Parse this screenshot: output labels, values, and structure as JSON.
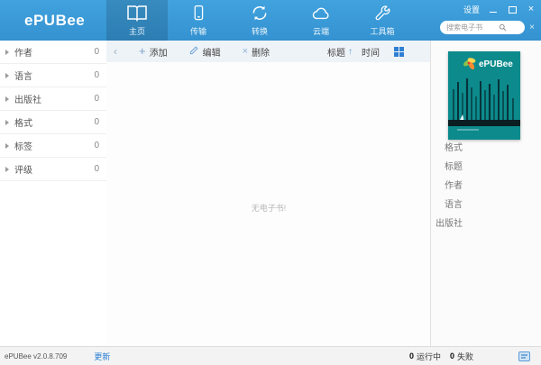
{
  "header": {
    "logo": "ePUBee",
    "settings_label": "设置",
    "nav": [
      {
        "label": "主页",
        "icon": "home-book-icon",
        "active": true
      },
      {
        "label": "传输",
        "icon": "transfer-phone-icon",
        "active": false
      },
      {
        "label": "转换",
        "icon": "convert-refresh-icon",
        "active": false
      },
      {
        "label": "云端",
        "icon": "cloud-icon",
        "active": false
      },
      {
        "label": "工具箱",
        "icon": "toolbox-wrench-icon",
        "active": false
      }
    ],
    "search": {
      "placeholder": "搜索电子书"
    }
  },
  "icons": {
    "back": "‹",
    "plus": "+",
    "delete_x": "×",
    "sort_up": "↑",
    "clear_x": "×",
    "close": "×"
  },
  "sidebar": {
    "items": [
      {
        "label": "作者",
        "count": "0"
      },
      {
        "label": "语言",
        "count": "0"
      },
      {
        "label": "出版社",
        "count": "0"
      },
      {
        "label": "格式",
        "count": "0"
      },
      {
        "label": "标签",
        "count": "0"
      },
      {
        "label": "评级",
        "count": "0"
      }
    ]
  },
  "toolbar": {
    "add_label": "添加",
    "edit_label": "编辑",
    "delete_label": "删除",
    "sort_title_label": "标题",
    "sort_time_label": "时间"
  },
  "main": {
    "empty_text": "无电子书!"
  },
  "detail_panel": {
    "cover_title": "ePUBee",
    "fields": [
      "格式",
      "标题",
      "作者",
      "语言",
      "出版社"
    ]
  },
  "statusbar": {
    "version": "ePUBee v2.0.8.709",
    "update_label": "更新",
    "running_count": "0",
    "running_label": "运行中",
    "failed_count": "0",
    "failed_label": "失败"
  },
  "colors": {
    "header_blue": "#3a9ad9",
    "accent_blue": "#2f7fd1",
    "cover_teal": "#0d8a8c"
  }
}
